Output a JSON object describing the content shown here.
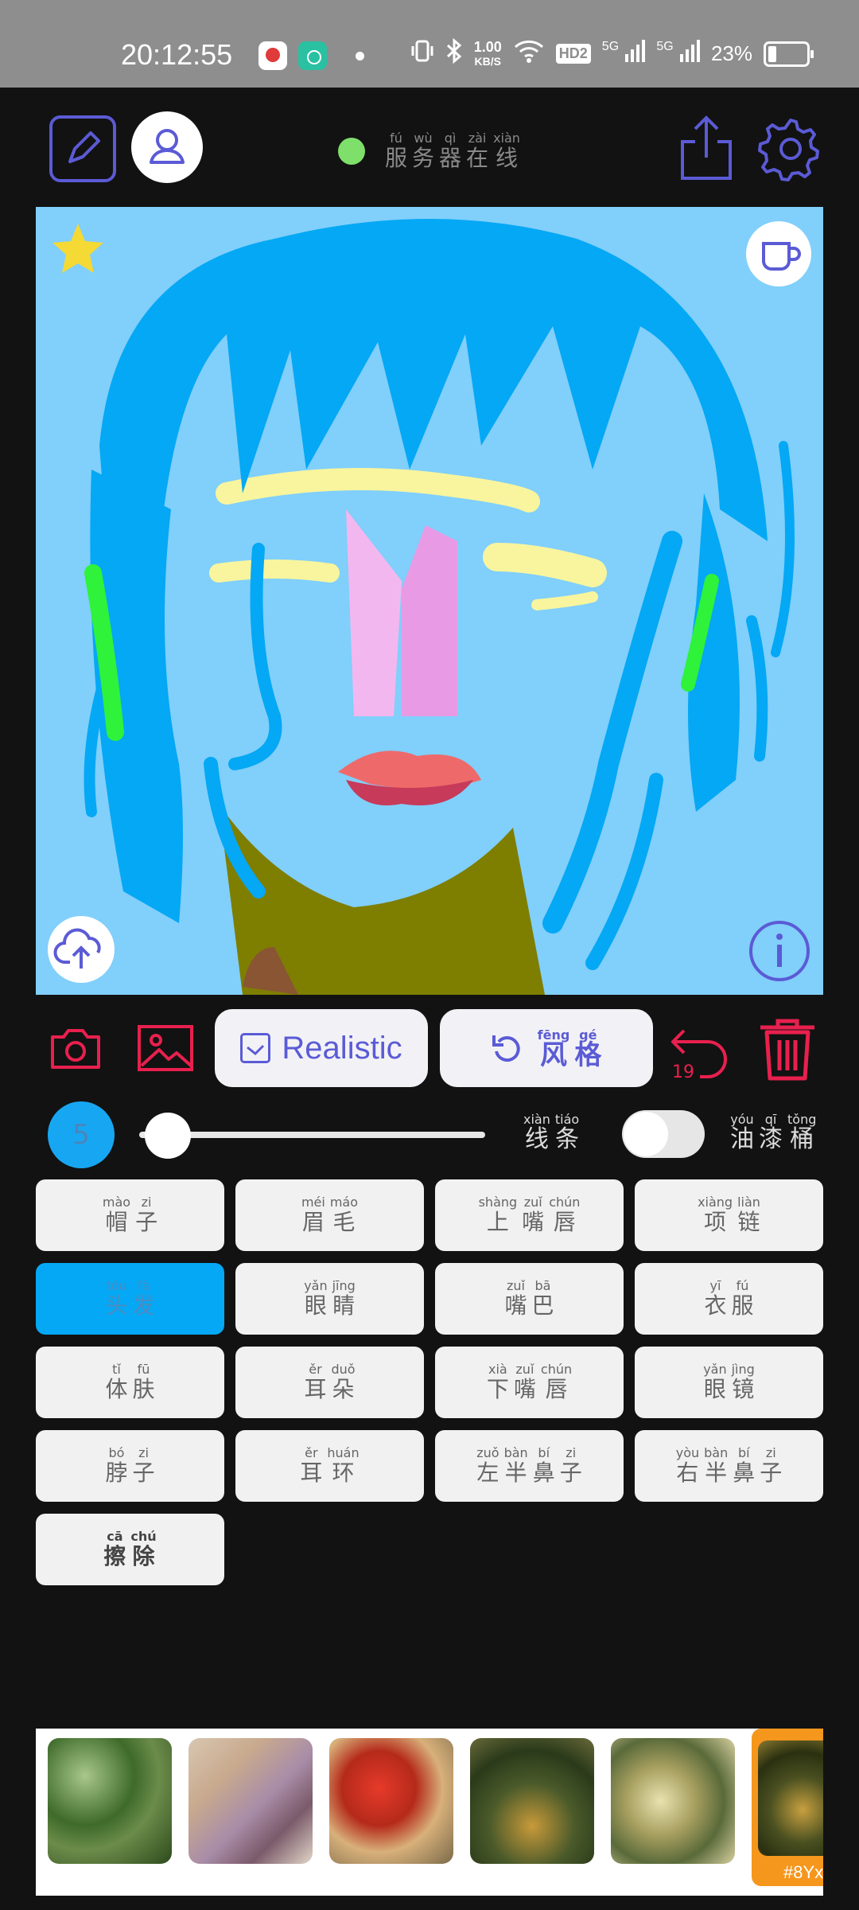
{
  "status_bar": {
    "time": "20:12:55",
    "net_speed_value": "1.00",
    "net_speed_unit": "KB/S",
    "hd_badge": "HD2",
    "signal1": "5G",
    "signal2": "5G",
    "battery": "23%"
  },
  "header": {
    "server_status": [
      {
        "py": "fú",
        "hz": "服"
      },
      {
        "py": "wù",
        "hz": "务"
      },
      {
        "py": "qì",
        "hz": "器"
      },
      {
        "py": "zài",
        "hz": "在"
      },
      {
        "py": "xiàn",
        "hz": "线"
      }
    ],
    "server_online_color": "#7ee06a"
  },
  "toolbar": {
    "realistic_label": "Realistic",
    "style_label": [
      {
        "py": "fēng",
        "hz": "风"
      },
      {
        "py": "gé",
        "hz": "格"
      }
    ],
    "undo_count": "19"
  },
  "brush": {
    "size": "5",
    "line_label": [
      {
        "py": "xiàn",
        "hz": "线"
      },
      {
        "py": "tiáo",
        "hz": "条"
      }
    ],
    "bucket_label": [
      {
        "py": "yóu",
        "hz": "油"
      },
      {
        "py": "qī",
        "hz": "漆"
      },
      {
        "py": "tǒng",
        "hz": "桶"
      }
    ],
    "slider_fraction": 0.05,
    "bucket_on": false
  },
  "parts": [
    {
      "chars": [
        {
          "py": "mào",
          "hz": "帽"
        },
        {
          "py": "zi",
          "hz": "子"
        }
      ]
    },
    {
      "chars": [
        {
          "py": "méi",
          "hz": "眉"
        },
        {
          "py": "máo",
          "hz": "毛"
        }
      ]
    },
    {
      "chars": [
        {
          "py": "shàng",
          "hz": "上"
        },
        {
          "py": "zuǐ",
          "hz": "嘴"
        },
        {
          "py": "chún",
          "hz": "唇"
        }
      ]
    },
    {
      "chars": [
        {
          "py": "xiàng",
          "hz": "项"
        },
        {
          "py": "liàn",
          "hz": "链"
        }
      ]
    },
    {
      "chars": [
        {
          "py": "tóu",
          "hz": "头"
        },
        {
          "py": "fà",
          "hz": "发"
        }
      ],
      "active": true
    },
    {
      "chars": [
        {
          "py": "yǎn",
          "hz": "眼"
        },
        {
          "py": "jīng",
          "hz": "睛"
        }
      ]
    },
    {
      "chars": [
        {
          "py": "zuǐ",
          "hz": "嘴"
        },
        {
          "py": "bā",
          "hz": "巴"
        }
      ]
    },
    {
      "chars": [
        {
          "py": "yī",
          "hz": "衣"
        },
        {
          "py": "fú",
          "hz": "服"
        }
      ]
    },
    {
      "chars": [
        {
          "py": "tǐ",
          "hz": "体"
        },
        {
          "py": "fū",
          "hz": "肤"
        }
      ]
    },
    {
      "chars": [
        {
          "py": "ěr",
          "hz": "耳"
        },
        {
          "py": "duǒ",
          "hz": "朵"
        }
      ]
    },
    {
      "chars": [
        {
          "py": "xià",
          "hz": "下"
        },
        {
          "py": "zuǐ",
          "hz": "嘴"
        },
        {
          "py": "chún",
          "hz": "唇"
        }
      ]
    },
    {
      "chars": [
        {
          "py": "yǎn",
          "hz": "眼"
        },
        {
          "py": "jìng",
          "hz": "镜"
        }
      ]
    },
    {
      "chars": [
        {
          "py": "bó",
          "hz": "脖"
        },
        {
          "py": "zi",
          "hz": "子"
        }
      ]
    },
    {
      "chars": [
        {
          "py": "ěr",
          "hz": "耳"
        },
        {
          "py": "huán",
          "hz": "环"
        }
      ]
    },
    {
      "chars": [
        {
          "py": "zuǒ",
          "hz": "左"
        },
        {
          "py": "bàn",
          "hz": "半"
        },
        {
          "py": "bí",
          "hz": "鼻"
        },
        {
          "py": "zi",
          "hz": "子"
        }
      ]
    },
    {
      "chars": [
        {
          "py": "yòu",
          "hz": "右"
        },
        {
          "py": "bàn",
          "hz": "半"
        },
        {
          "py": "bí",
          "hz": "鼻"
        },
        {
          "py": "zi",
          "hz": "子"
        }
      ]
    },
    {
      "chars": [
        {
          "py": "cā",
          "hz": "擦"
        },
        {
          "py": "chú",
          "hz": "除"
        }
      ],
      "erase": true
    }
  ],
  "style_thumbs": {
    "selected_tag": "#8Yx"
  },
  "colors": {
    "accent": "#5b5bd6",
    "danger": "#e8204e",
    "canvas_bg": "#81cffb",
    "hair": "#05a8f4",
    "active_part": "#05a8f4",
    "selected_thumb": "#f5961d"
  }
}
